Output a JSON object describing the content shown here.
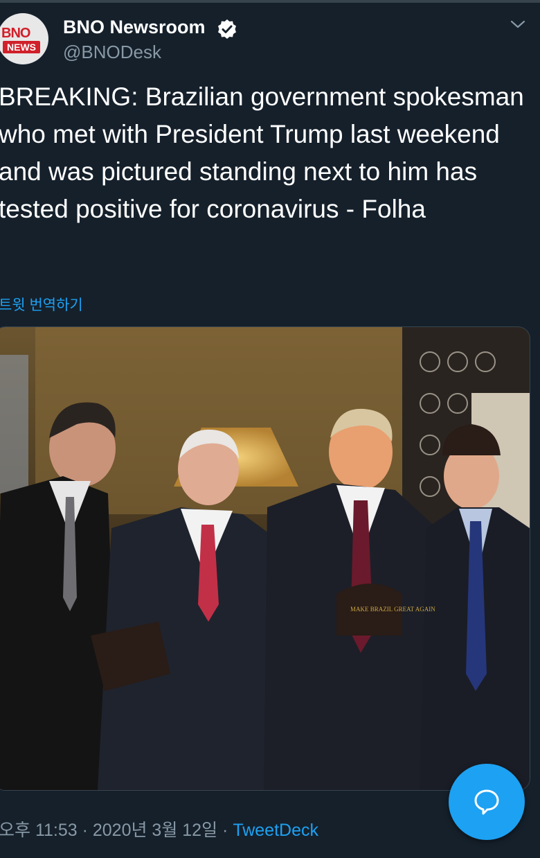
{
  "tweet": {
    "author": {
      "name": "BNO Newsroom",
      "handle": "@BNODesk",
      "avatar_logo_text_top": "BNO",
      "avatar_logo_text_bottom": "NEWS"
    },
    "text": "BREAKING: Brazilian government spokesman who met with President Trump last weekend and was pictured standing next to him has tested positive for coronavirus - Folha",
    "translate_label": "트윗 번역하기",
    "media": {
      "hat_text": "MAKE BRAZIL GREAT AGAIN"
    },
    "timestamp": "오후 11:53 · 2020년 3월 12일 · ",
    "source": "TweetDeck"
  },
  "icons": {
    "verified": "verified-badge-icon",
    "more": "chevron-down-icon",
    "compose": "chat-bubble-icon"
  },
  "colors": {
    "background": "#15202b",
    "accent": "#1da1f2",
    "secondary_text": "#8899a6",
    "brand_red": "#d0202a"
  }
}
